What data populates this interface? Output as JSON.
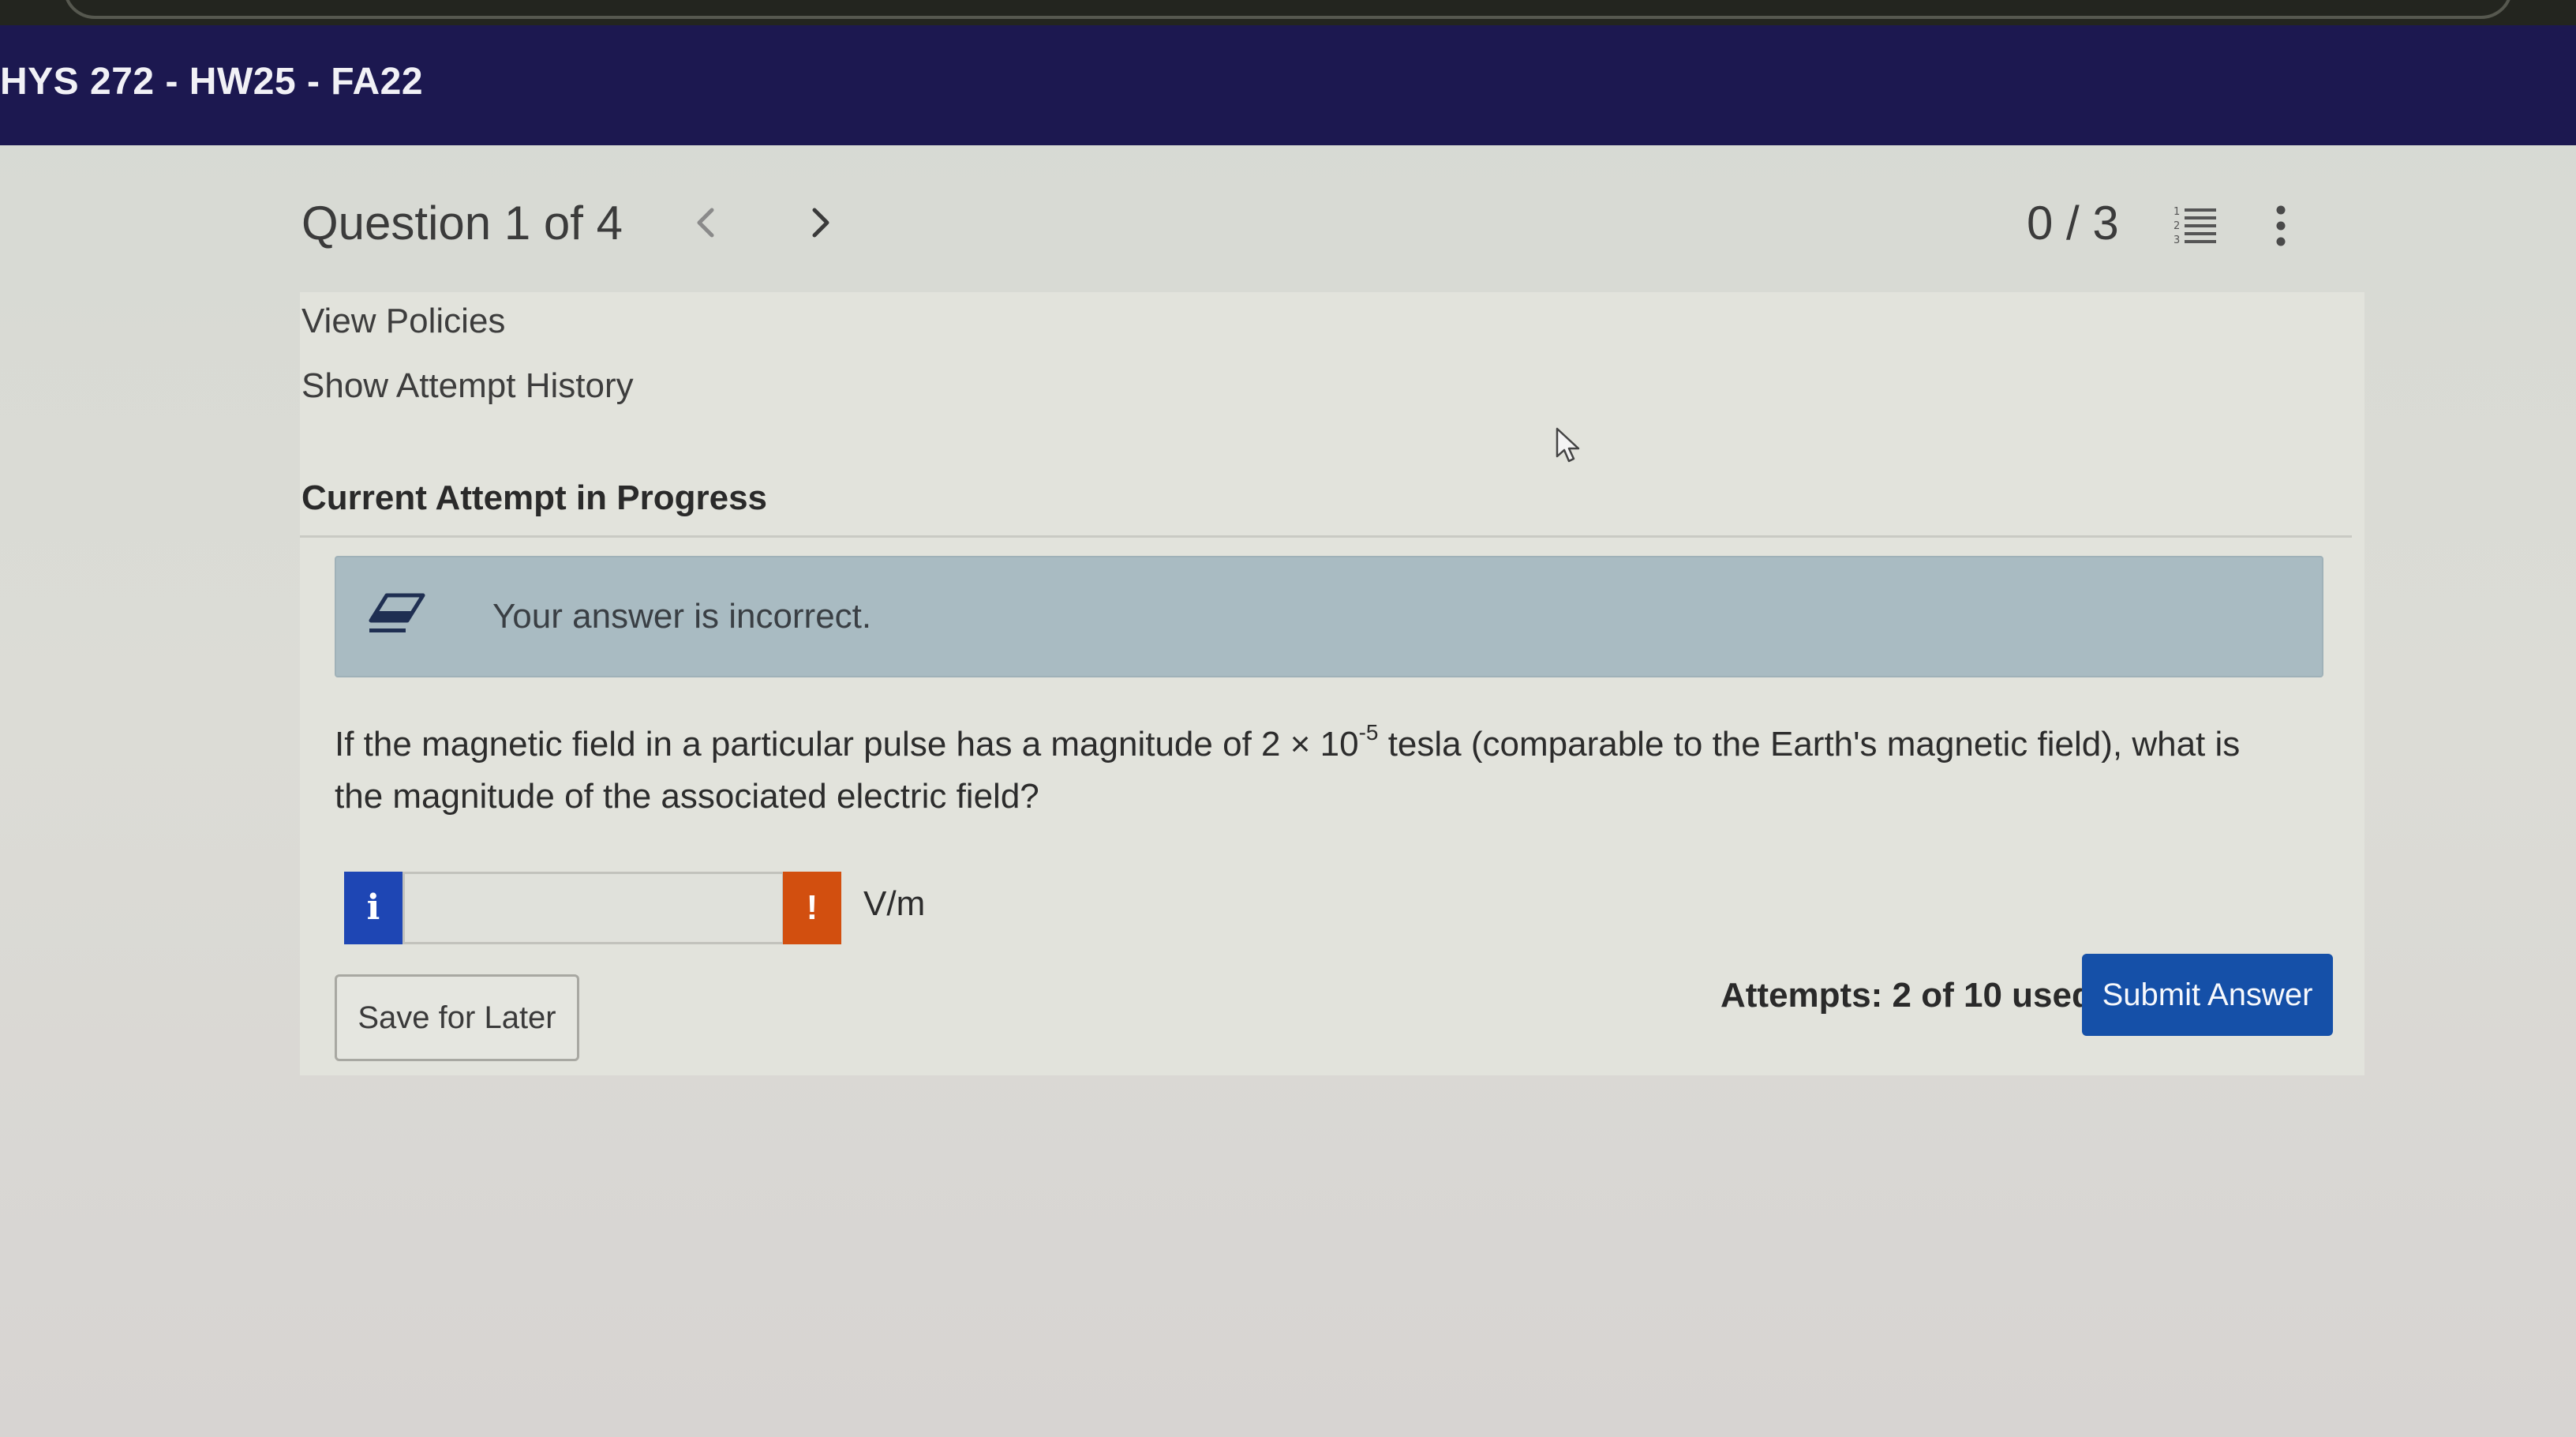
{
  "header": {
    "course_title": "HYS 272 - HW25 - FA22"
  },
  "question_bar": {
    "title": "Question 1 of 4",
    "prev_icon": "chevron-left-icon",
    "next_icon": "chevron-right-icon",
    "score": "0 / 3",
    "list_icon": "numbered-list-icon",
    "more_icon": "vertical-dots-icon"
  },
  "links": {
    "view_policies": "View Policies",
    "show_attempt_history": "Show Attempt History"
  },
  "attempt": {
    "heading": "Current Attempt in Progress"
  },
  "feedback": {
    "icon": "eraser-icon",
    "message": "Your answer is incorrect.",
    "color": "#a9bbc2"
  },
  "question": {
    "text_before": "If the magnetic field in a particular pulse has a magnitude of 2 × 10",
    "exponent": "-5",
    "text_after": " tesla (comparable to the Earth's magnetic field), what is the magnitude of the associated electric field?"
  },
  "answer": {
    "info_label": "i",
    "value": "",
    "warning_label": "!",
    "unit": "V/m",
    "info_color": "#1e46b4",
    "warning_color": "#d24f0f"
  },
  "actions": {
    "save_label": "Save for Later",
    "attempts_text": "Attempts: 2 of 10 used",
    "submit_label": "Submit Answer",
    "submit_color": "#1550a8"
  }
}
